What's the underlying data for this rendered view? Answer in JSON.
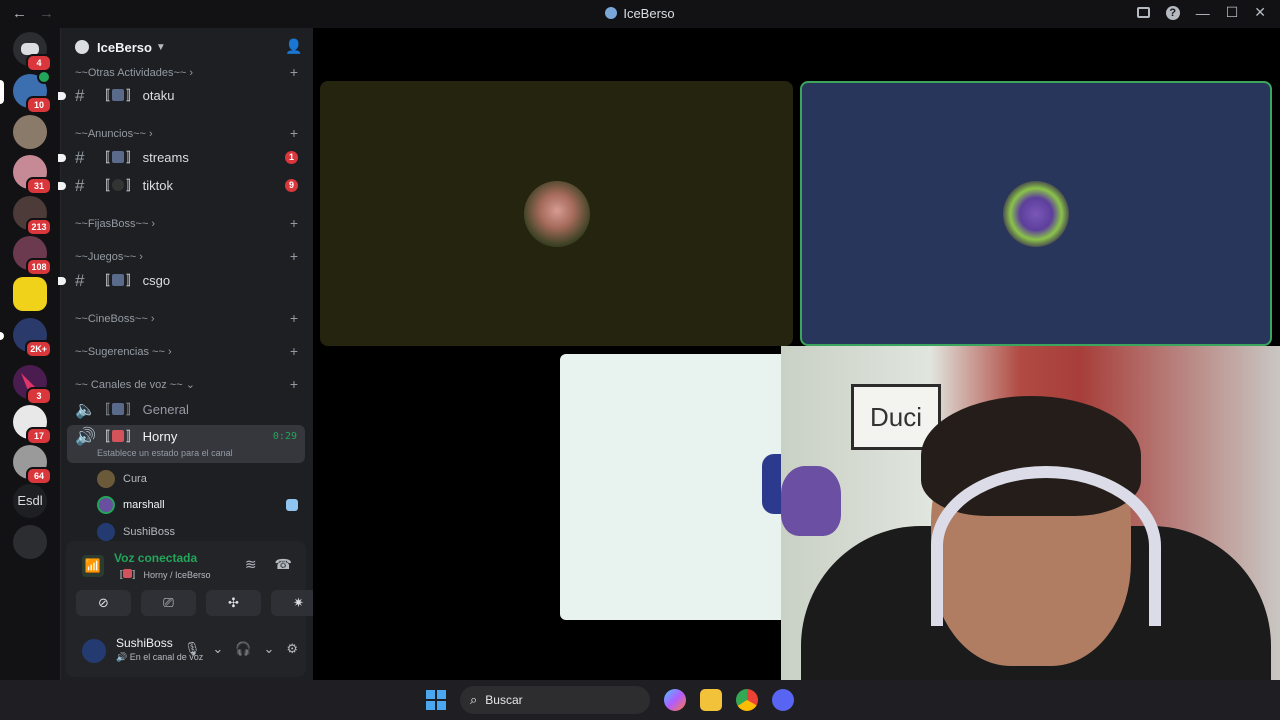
{
  "window": {
    "title": "IceBerso"
  },
  "guilds": [
    {
      "badge": "4"
    },
    {
      "badge": "10"
    },
    {
      "badge": ""
    },
    {
      "badge": "31"
    },
    {
      "badge": "213"
    },
    {
      "badge": "108"
    },
    {
      "badge": ""
    },
    {
      "badge": "2K+"
    },
    {
      "badge": "3"
    },
    {
      "badge": "17"
    },
    {
      "badge": "64"
    }
  ],
  "guild_text": "Esdl",
  "server": {
    "name": "IceBerso"
  },
  "channels": {
    "cat_otras": "~~Otras Actividades~~",
    "otaku": "otaku",
    "cat_anuncios": "~~Anuncios~~",
    "streams": "streams",
    "streams_badge": "1",
    "tiktok": "tiktok",
    "tiktok_badge": "9",
    "cat_fijas": "~~FijasBoss~~",
    "cat_juegos": "~~Juegos~~",
    "csgo": "csgo",
    "cat_cine": "~~CineBoss~~",
    "cat_sugerencias": "~~Sugerencias ~~",
    "cat_voz": "~~ Canales de voz ~~",
    "general": "General",
    "horny": "Horny",
    "horny_timer": "0:29",
    "horny_status": "Establece un estado para el canal"
  },
  "voice_users": [
    "Cura",
    "marshall",
    "SushiBoss"
  ],
  "voice_panel": {
    "status": "Voz conectada",
    "path": "Horny / IceBerso"
  },
  "user": {
    "name": "SushiBoss",
    "status": "En el canal de voz"
  },
  "webcam": {
    "poster_text": "Duci"
  },
  "taskbar": {
    "search_label": "Buscar"
  },
  "colors": {
    "accent_green": "#23a55a",
    "badge_red": "#da373c",
    "tile_blue": "#27365a"
  }
}
